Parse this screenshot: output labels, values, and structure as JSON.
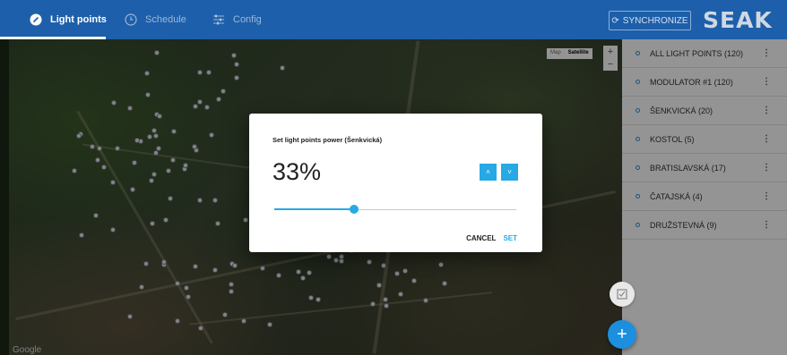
{
  "topbar": {
    "tabs": [
      {
        "label": "Light points",
        "icon": "lightbulb-icon",
        "active": true
      },
      {
        "label": "Schedule",
        "icon": "clock-icon",
        "active": false
      },
      {
        "label": "Config",
        "icon": "sliders-icon",
        "active": false
      }
    ],
    "sync_label": "SYNCHRONIZE",
    "logo_text": "SEAK"
  },
  "map": {
    "type_options": [
      "Map",
      "Satellite"
    ],
    "selected_type": "Satellite",
    "zoom_in": "+",
    "zoom_out": "−",
    "attribution": "Google"
  },
  "panel": {
    "items": [
      {
        "label": "ALL LIGHT POINTS (120)"
      },
      {
        "label": "MODULATOR #1 (120)"
      },
      {
        "label": "ŠENKVICKÁ (20)"
      },
      {
        "label": "KOSTOL (5)"
      },
      {
        "label": "BRATISLAVSKÁ (17)"
      },
      {
        "label": "ČATAJSKÁ (4)"
      },
      {
        "label": "DRUŽSTEVNÁ (9)"
      }
    ],
    "more_glyph": "⋮"
  },
  "dialog": {
    "title": "Set light points power (Šenkvická)",
    "value_text": "33%",
    "value": 33,
    "max": 100,
    "up_glyph": "˄",
    "down_glyph": "˅",
    "cancel_label": "CANCEL",
    "set_label": "SET"
  },
  "colors": {
    "topbar": "#1d5faa",
    "accent": "#26a9e5",
    "fab": "#1d8fe0"
  }
}
